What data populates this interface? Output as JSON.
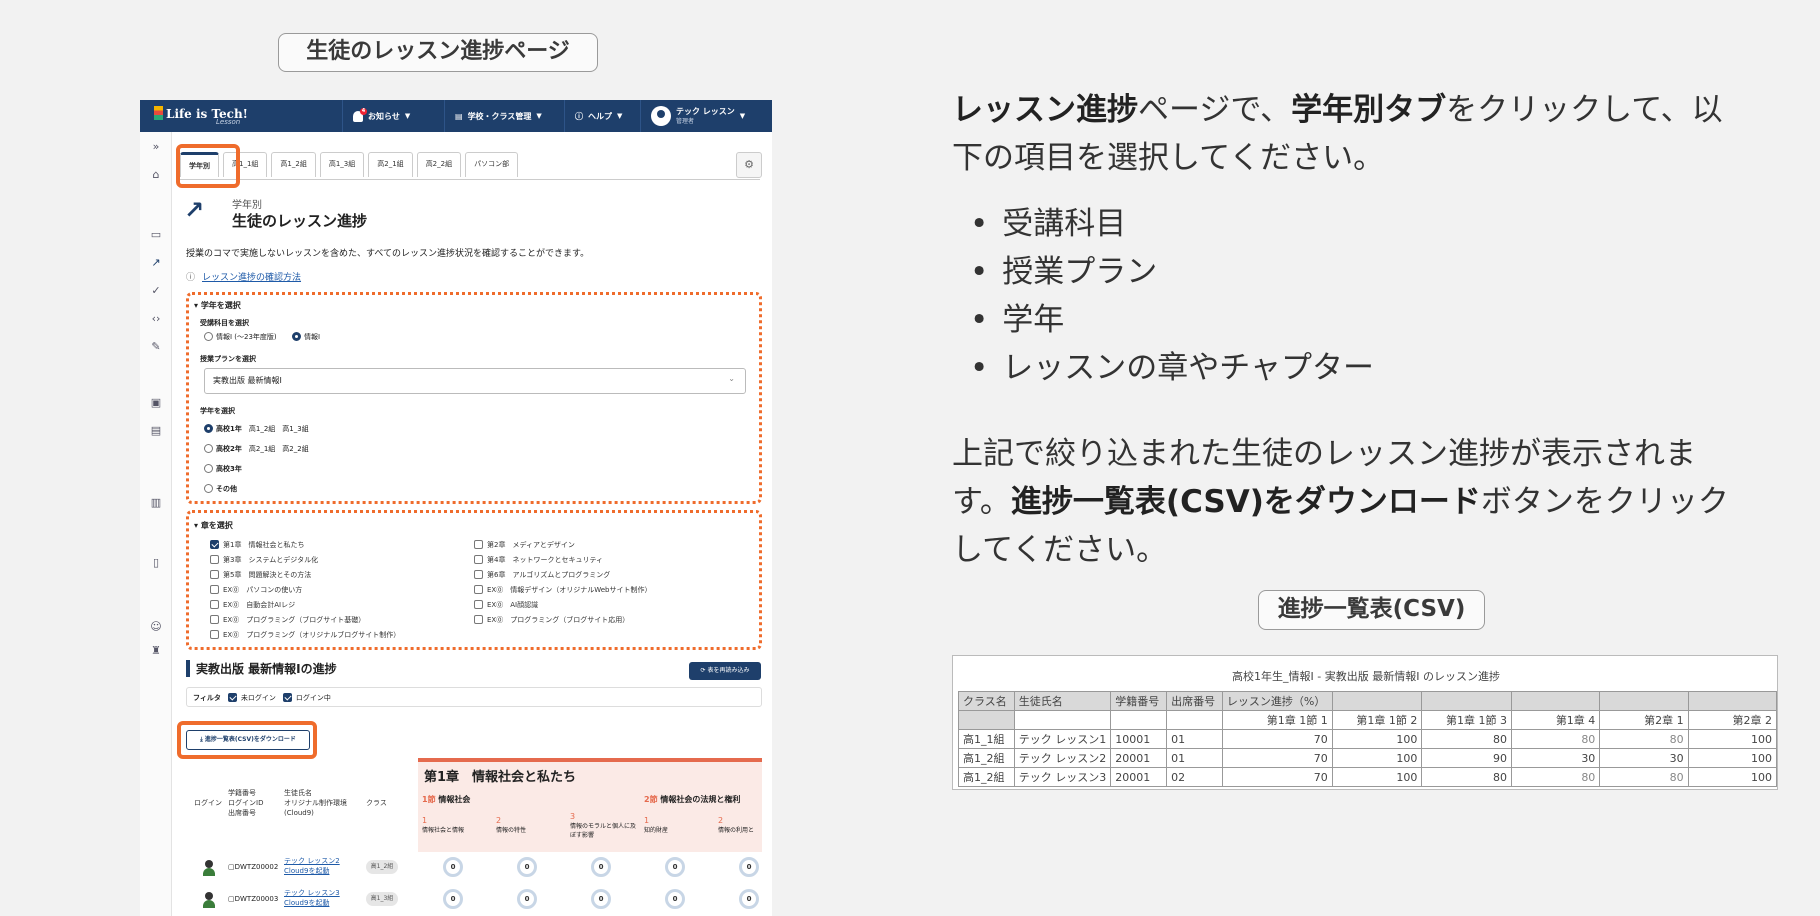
{
  "page_pill": "生徒のレッスン進捗ページ",
  "app": {
    "logo": "Life is Tech!",
    "logo_sub": "Lesson",
    "nav_notice": "お知らせ",
    "notice_count": "4",
    "nav_school": "学校・クラス管理",
    "nav_help": "ヘルプ",
    "user_name": "テック レッスン",
    "user_role": "管理者"
  },
  "tabs": [
    "学年別",
    "高1_1組",
    "高1_2組",
    "高1_3組",
    "高2_1組",
    "高2_2組",
    "パソコン部"
  ],
  "heading": {
    "kicker": "学年別",
    "title": "生徒のレッスン進捗",
    "description": "授業のコマで実施しないレッスンを含めた、すべてのレッスン進捗状況を確認することができます。",
    "help_link": "レッスン進捗の確認方法"
  },
  "grade_section": {
    "header": "学年を選択",
    "subject_label": "受講科目を選択",
    "subject_options": [
      "情報I (〜23年度版)",
      "情報I"
    ],
    "plan_label": "授業プランを選択",
    "plan_value": "実教出版 最新情報I",
    "grade_label": "学年を選択",
    "grades": [
      {
        "name": "高校1年",
        "classes": "高1_2組　高1_3組"
      },
      {
        "name": "高校2年",
        "classes": "高2_1組　高2_2組"
      },
      {
        "name": "高校3年",
        "classes": ""
      },
      {
        "name": "その他",
        "classes": ""
      }
    ]
  },
  "chapter_section": {
    "header": "章を選択",
    "left": [
      "第1章　情報社会と私たち",
      "第3章　システムとデジタル化",
      "第5章　問題解決とその方法",
      "EX⓪　パソコンの使い方",
      "EX⓪　自動会計AIレジ",
      "EX⓪　プログラミング（ブログサイト基礎）",
      "EX⓪　プログラミング（オリジナルブログサイト制作）"
    ],
    "right": [
      "第2章　メディアとデザイン",
      "第4章　ネットワークとセキュリティ",
      "第6章　アルゴリズムとプログラミング",
      "EX⓪　情報デザイン（オリジナルWebサイト制作）",
      "EX⓪　AI顔認識",
      "EX⓪　プログラミング（ブログサイト応用）"
    ]
  },
  "progress": {
    "title": "実教出版 最新情報Iの進捗",
    "reload_button": "表を再読み込み",
    "filter_label": "フィルタ",
    "filter_not_logged": "未ログイン",
    "filter_logged": "ログイン中",
    "download_button": "進捗一覧表(CSV)をダウンロード",
    "col_login": "ログイン",
    "col_ids": "学籍番号\nログインID\n出席番号",
    "col_name": "生徒氏名\nオリジナル制作環境\n(Cloud9)",
    "col_class": "クラス",
    "chapter_title": "第1章　情報社会と私たち",
    "section1": "情報社会",
    "section1_num": "1節",
    "section2": "情報社会の法規と権利",
    "section2_num": "2節",
    "lessons": [
      {
        "num": "1",
        "name": "情報社会と情報"
      },
      {
        "num": "2",
        "name": "情報の特性"
      },
      {
        "num": "3",
        "name": "情報のモラルと個人に及ぼす影響"
      },
      {
        "num": "1",
        "name": "知的財産"
      },
      {
        "num": "2",
        "name": "情報の利用と"
      }
    ],
    "rows": [
      {
        "id": "DWTZ00002",
        "name": "テック レッスン2",
        "cloud9": "Cloud9を起動",
        "class": "高1_2組",
        "values": [
          "0",
          "0",
          "0",
          "0",
          "0"
        ]
      },
      {
        "id": "DWTZ00003",
        "name": "テック レッスン3",
        "cloud9": "Cloud9を起動",
        "class": "高1_3組",
        "values": [
          "0",
          "0",
          "0",
          "0",
          "0"
        ]
      }
    ]
  },
  "instructions": {
    "p1_bold1": "レッスン進捗",
    "p1_text1": "ページで、",
    "p1_bold2": "学年別タブ",
    "p1_text2": "をクリックして、以",
    "p1_line2": "下の項目を選択してください。",
    "bullets": [
      "受講科目",
      "授業プラン",
      "学年",
      "レッスンの章やチャプター"
    ],
    "p2_line1": "上記で絞り込まれた生徒のレッスン進捗が表示されま",
    "p2_text_a": "す。",
    "p2_bold": "進捗一覧表(CSV)をダウンロード",
    "p2_text_b": "ボタンをクリック",
    "p2_line3": "してください。"
  },
  "csv_pill": "進捗一覧表(CSV)",
  "csv": {
    "title": "高校1年生_情報Ⅰ - 実教出版 最新情報Ⅰ のレッスン進捗",
    "header1": [
      "クラス名",
      "生徒氏名",
      "学籍番号",
      "出席番号",
      "レッスン進捗（%）",
      "",
      "",
      "",
      "",
      ""
    ],
    "header2": [
      "",
      "",
      "",
      "",
      "第1章 1節 1",
      "第1章 1節 2",
      "第1章 1節 3",
      "第1章 4",
      "第2章 1",
      "第2章 2"
    ],
    "rows": [
      [
        "高1_1組",
        "テック レッスン1",
        "10001",
        "01",
        "70",
        "100",
        "80",
        "80",
        "80",
        "100"
      ],
      [
        "高1_2組",
        "テック レッスン2",
        "20001",
        "01",
        "70",
        "100",
        "90",
        "30",
        "30",
        "100"
      ],
      [
        "高1_2組",
        "テック レッスン3",
        "20001",
        "02",
        "70",
        "100",
        "80",
        "80",
        "80",
        "100"
      ]
    ]
  },
  "colors": {
    "navy": "#1e3f6b",
    "highlight": "#ef6c2c",
    "chapter": "#e56a4d"
  }
}
